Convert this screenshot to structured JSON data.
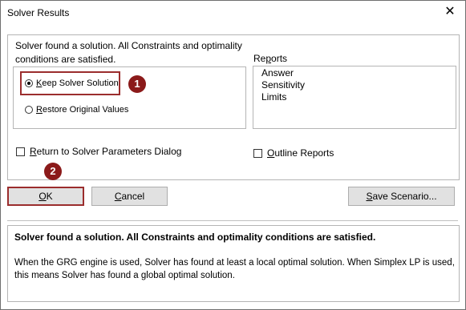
{
  "window": {
    "title": "Solver Results",
    "close_glyph": "✕"
  },
  "message": {
    "line1": "Solver found a solution.  All Constraints and optimality",
    "line2": "conditions are satisfied."
  },
  "options": {
    "keep": {
      "pre": "",
      "hot": "K",
      "post": "eep Solver Solution"
    },
    "restore": {
      "pre": "",
      "hot": "R",
      "post": "estore Original Values"
    },
    "return_dialog": {
      "pre": "",
      "hot": "R",
      "post": "eturn to Solver Parameters Dialog"
    },
    "outline": {
      "pre": "",
      "hot": "O",
      "post": "utline Reports"
    }
  },
  "reports": {
    "label_pre": "Re",
    "label_hot": "p",
    "label_post": "orts",
    "items": [
      "Answer",
      "Sensitivity",
      "Limits"
    ]
  },
  "badges": {
    "one": "1",
    "two": "2"
  },
  "buttons": {
    "ok": {
      "pre": "",
      "hot": "O",
      "post": "K"
    },
    "cancel": {
      "pre": "",
      "hot": "C",
      "post": "ancel"
    },
    "save": {
      "pre": "",
      "hot": "S",
      "post": "ave Scenario..."
    }
  },
  "status": {
    "bold": "Solver found a solution.  All Constraints and optimality conditions are satisfied.",
    "detail": "When the GRG engine is used, Solver has found at least a local optimal solution. When Simplex LP is used, this means Solver has found a global optimal solution."
  },
  "colors": {
    "annotation": "#8b1a1a"
  }
}
